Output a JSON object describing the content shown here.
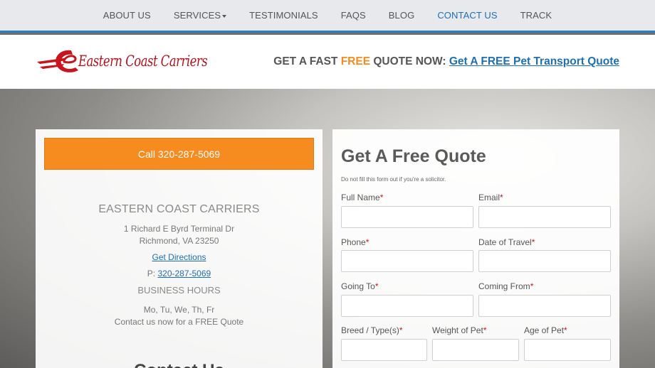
{
  "nav": {
    "items": [
      {
        "label": "ABOUT US",
        "active": false,
        "dropdown": false
      },
      {
        "label": "SERVICES",
        "active": false,
        "dropdown": true
      },
      {
        "label": "TESTIMONIALS",
        "active": false,
        "dropdown": false
      },
      {
        "label": "FAQS",
        "active": false,
        "dropdown": false
      },
      {
        "label": "BLOG",
        "active": false,
        "dropdown": false
      },
      {
        "label": "CONTACT US",
        "active": true,
        "dropdown": false
      },
      {
        "label": "TRACK",
        "active": false,
        "dropdown": false
      }
    ],
    "accent": "#2a7fc1"
  },
  "header": {
    "logo_text": "Eastern Coast Carriers",
    "quote_prefix": "GET A FAST ",
    "quote_free": "FREE",
    "quote_suffix": " QUOTE NOW: ",
    "quote_link": "Get A FREE Pet Transport Quote"
  },
  "left": {
    "call_button": "Call 320-287-5069",
    "company_name": "EASTERN COAST CARRIERS",
    "address_line1": "1 Richard E Byrd Terminal Dr",
    "address_line2": "Richmond, VA 23250",
    "directions_link": "Get Directions",
    "phone_prefix": "P: ",
    "phone_link": "320-287-5069",
    "hours_title": "BUSINESS HOURS",
    "hours_days": "Mo, Tu, We, Th, Fr",
    "hours_note": "Contact us now for a FREE Quote",
    "contact_heading": "Contact Us"
  },
  "form": {
    "title": "Get A Free Quote",
    "honeypot_note": "Do not fill this form out if you're a solicitor.",
    "required_mark": "*",
    "fields": {
      "full_name": "Full Name",
      "email": "Email",
      "phone": "Phone",
      "date_of_travel": "Date of Travel",
      "going_to": "Going To",
      "coming_from": "Coming From",
      "breed": "Breed / Type(s)",
      "weight": "Weight of Pet",
      "age": "Age of Pet"
    }
  },
  "colors": {
    "orange": "#f68b1f",
    "link_blue": "#1d6fb5",
    "required_red": "#c0171e",
    "logo_red": "#b3121b"
  }
}
